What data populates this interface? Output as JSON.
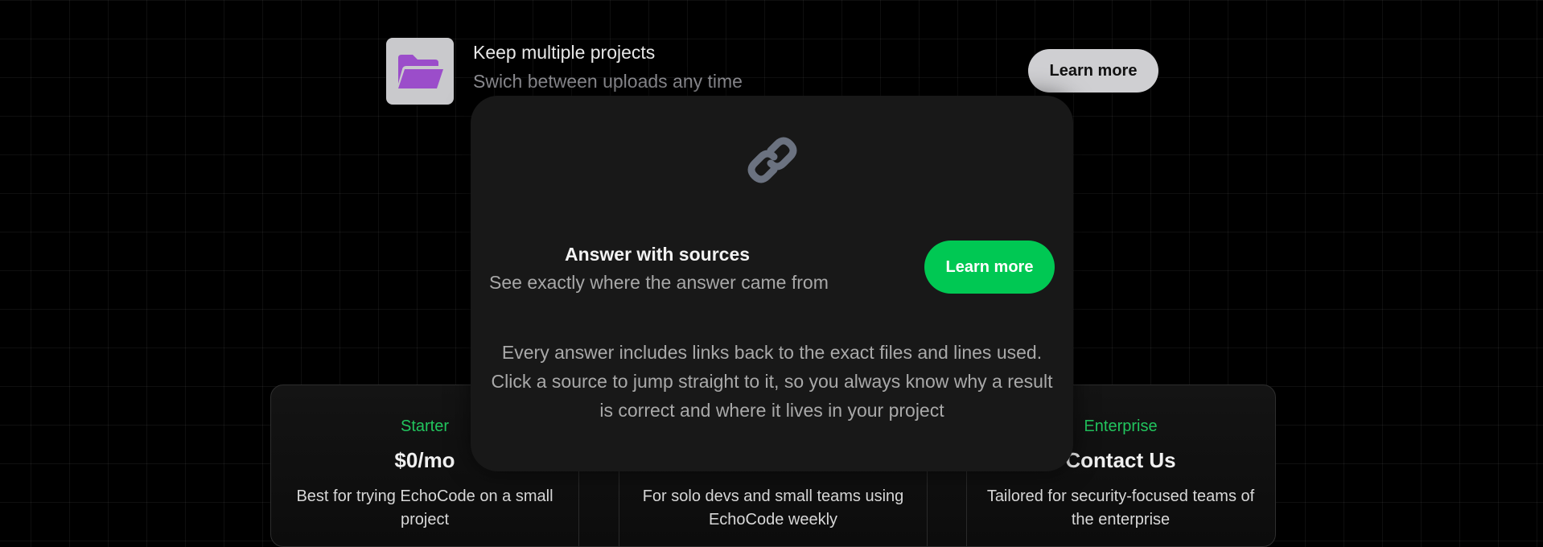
{
  "feature": {
    "title": "Keep multiple projects",
    "subtitle": "Swich between uploads any time",
    "button_label": "Learn more",
    "icon": "folder-icon",
    "icon_color": "#9b4dca"
  },
  "pricing": {
    "cards": [
      {
        "tier": "Starter",
        "price": "$0/mo",
        "description": "Best for trying EchoCode on a small project"
      },
      {
        "tier": "",
        "price": "",
        "description": "For solo devs and small teams using EchoCode weekly"
      },
      {
        "tier": "Enterprise",
        "price": "Contact Us",
        "description": "Tailored for security-focused teams of the enterprise"
      }
    ],
    "accent_color": "#22c55e"
  },
  "modal": {
    "icon": "link-icon",
    "title": "Answer with sources",
    "subtitle": "See exactly where the answer came from",
    "button_label": "Learn more",
    "button_color": "#00c853",
    "body": "Every answer includes links back to the exact files and lines used. Click a source to jump straight to it, so you always know why a result is correct and where it lives in your project"
  }
}
